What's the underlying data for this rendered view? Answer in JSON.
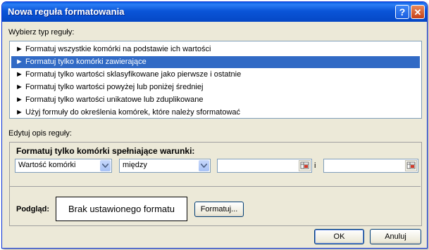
{
  "window": {
    "title": "Nowa reguła formatowania",
    "help_label": "?",
    "close_label": "✕"
  },
  "rule_type": {
    "label": "Wybierz typ reguły:",
    "items": [
      {
        "label": "► Formatuj wszystkie komórki na podstawie ich wartości",
        "selected": false
      },
      {
        "label": "► Formatuj tylko komórki zawierające",
        "selected": true
      },
      {
        "label": "► Formatuj tylko wartości sklasyfikowane jako pierwsze i ostatnie",
        "selected": false
      },
      {
        "label": "► Formatuj tylko wartości powyżej lub poniżej średniej",
        "selected": false
      },
      {
        "label": "► Formatuj tylko wartości unikatowe lub zduplikowane",
        "selected": false
      },
      {
        "label": "► Użyj formuły do określenia komórek, które należy sformatować",
        "selected": false
      }
    ]
  },
  "edit": {
    "label": "Edytuj opis reguły:",
    "heading": "Formatuj tylko komórki spełniające warunki:",
    "condition_value": "Wartość komórki",
    "operator_value": "między",
    "first_value": "",
    "and_label": "i",
    "second_value": "",
    "preview_label": "Podgląd:",
    "preview_text": "Brak ustawionego formatu",
    "format_button": "Formatuj..."
  },
  "buttons": {
    "ok": "OK",
    "cancel": "Anuluj"
  },
  "colors": {
    "titlebar": "#0a55d8",
    "selection": "#316ac5",
    "face": "#ece9d8"
  }
}
